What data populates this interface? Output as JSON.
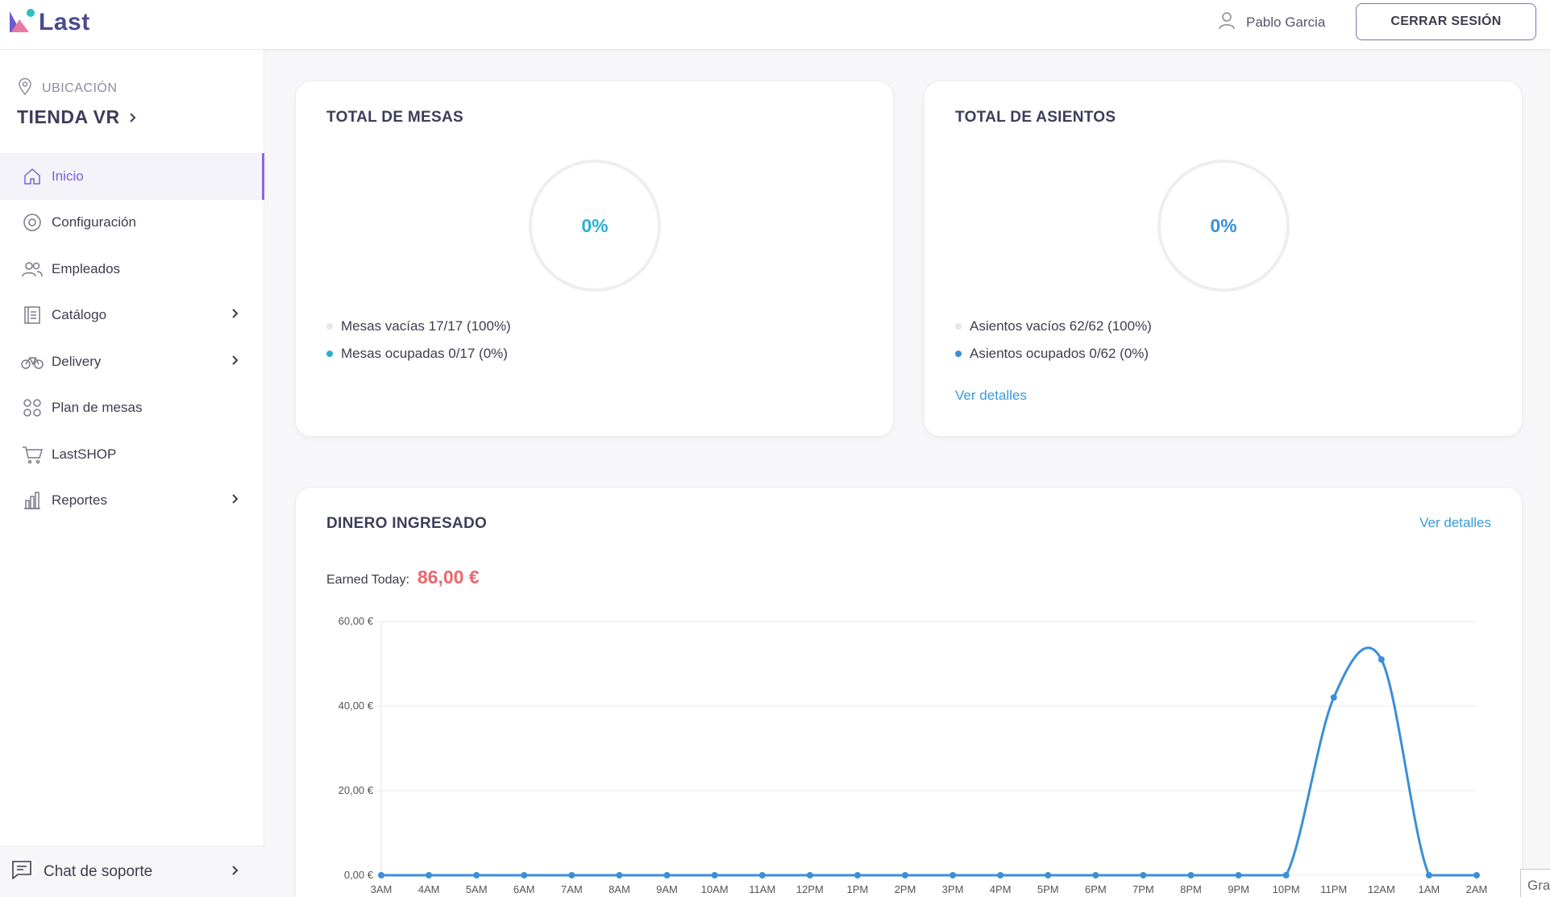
{
  "header": {
    "logo_text": "Last",
    "user_name": "Pablo Garcia",
    "logout_label": "CERRAR SESIÓN"
  },
  "sidebar": {
    "location_label": "UBICACIÓN",
    "store_name": "TIENDA VR",
    "items": [
      {
        "label": "Inicio",
        "icon": "home-icon",
        "active": true,
        "has_children": false
      },
      {
        "label": "Configuración",
        "icon": "gear-icon",
        "active": false,
        "has_children": false
      },
      {
        "label": "Empleados",
        "icon": "users-icon",
        "active": false,
        "has_children": false
      },
      {
        "label": "Catálogo",
        "icon": "catalog-icon",
        "active": false,
        "has_children": true
      },
      {
        "label": "Delivery",
        "icon": "bicycle-icon",
        "active": false,
        "has_children": true
      },
      {
        "label": "Plan de mesas",
        "icon": "tables-icon",
        "active": false,
        "has_children": false
      },
      {
        "label": "LastSHOP",
        "icon": "cart-icon",
        "active": false,
        "has_children": false
      },
      {
        "label": "Reportes",
        "icon": "bar-chart-icon",
        "active": false,
        "has_children": true
      }
    ],
    "support_label": "Chat de soporte"
  },
  "tables_card": {
    "title": "TOTAL DE MESAS",
    "percent": "0%",
    "legend": [
      {
        "label": "Mesas vacías 17/17 (100%)",
        "color": "#e6e6ea"
      },
      {
        "label": "Mesas ocupadas 0/17 (0%)",
        "color": "#2bb0d0"
      }
    ]
  },
  "seats_card": {
    "title": "TOTAL DE ASIENTOS",
    "percent": "0%",
    "legend": [
      {
        "label": "Asientos vacíos 62/62 (100%)",
        "color": "#e6e6ea"
      },
      {
        "label": "Asientos ocupados 0/62 (0%)",
        "color": "#3a8fd9"
      }
    ],
    "details_link": "Ver detalles"
  },
  "income_card": {
    "title": "DINERO INGRESADO",
    "details_link": "Ver detalles",
    "earned_label": "Earned Today:",
    "earned_value": "86,00 €"
  },
  "partial_text": "Gra",
  "colors": {
    "accent": "#8a67e3",
    "line": "#3a8fd9",
    "earned": "#e8686d",
    "tables_percent": "#2bb0d0",
    "seats_percent": "#3a8fd9"
  },
  "chart_data": {
    "type": "line",
    "title": "",
    "xlabel": "",
    "ylabel": "",
    "categories": [
      "3AM",
      "4AM",
      "5AM",
      "6AM",
      "7AM",
      "8AM",
      "9AM",
      "10AM",
      "11AM",
      "12PM",
      "1PM",
      "2PM",
      "3PM",
      "4PM",
      "5PM",
      "6PM",
      "7PM",
      "8PM",
      "9PM",
      "10PM",
      "11PM",
      "12AM",
      "1AM",
      "2AM"
    ],
    "series": [
      {
        "values": [
          0,
          0,
          0,
          0,
          0,
          0,
          0,
          0,
          0,
          0,
          0,
          0,
          0,
          0,
          0,
          0,
          0,
          0,
          0,
          0,
          42,
          51,
          0,
          0
        ]
      }
    ],
    "y_ticks": [
      "0,00 €",
      "20,00 €",
      "40,00 €",
      "60,00 €"
    ],
    "y_tick_values": [
      0,
      20,
      40,
      60
    ],
    "ylim": [
      0,
      60
    ],
    "grid": true,
    "legend": "none"
  }
}
